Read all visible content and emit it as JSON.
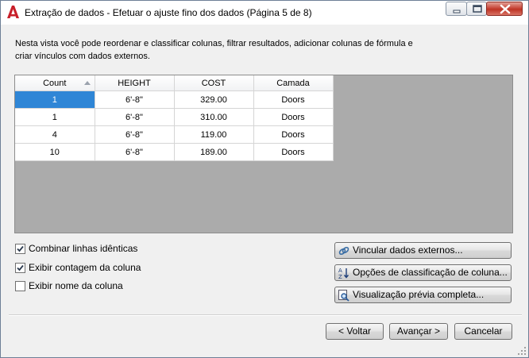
{
  "window": {
    "title": "Extração de dados - Efetuar o ajuste fino dos dados (Página 5 de 8)",
    "icon": "autocad-a-icon",
    "accent_color": "#c8473a"
  },
  "description": "Nesta vista você pode reordenar e classificar colunas, filtrar resultados, adicionar colunas de fórmula e criar vínculos com dados externos.",
  "grid": {
    "columns": [
      "Count",
      "HEIGHT",
      "COST",
      "Camada"
    ],
    "rows": [
      [
        "1",
        "6'-8\"",
        "329.00",
        "Doors"
      ],
      [
        "1",
        "6'-8\"",
        "310.00",
        "Doors"
      ],
      [
        "4",
        "6'-8\"",
        "119.00",
        "Doors"
      ],
      [
        "10",
        "6'-8\"",
        "189.00",
        "Doors"
      ]
    ],
    "selection_color": "#2f86d6"
  },
  "options": {
    "combine_identical": {
      "label": "Combinar linhas idênticas",
      "checked": true
    },
    "show_count": {
      "label": "Exibir contagem da coluna",
      "checked": true
    },
    "show_name": {
      "label": "Exibir nome da coluna",
      "checked": false
    }
  },
  "actions": {
    "link_external": "Vincular dados externos...",
    "sort_options": "Opções de classificação de coluna...",
    "full_preview": "Visualização prévia completa..."
  },
  "footer": {
    "back": "< Voltar",
    "next": "Avançar >",
    "cancel": "Cancelar"
  }
}
